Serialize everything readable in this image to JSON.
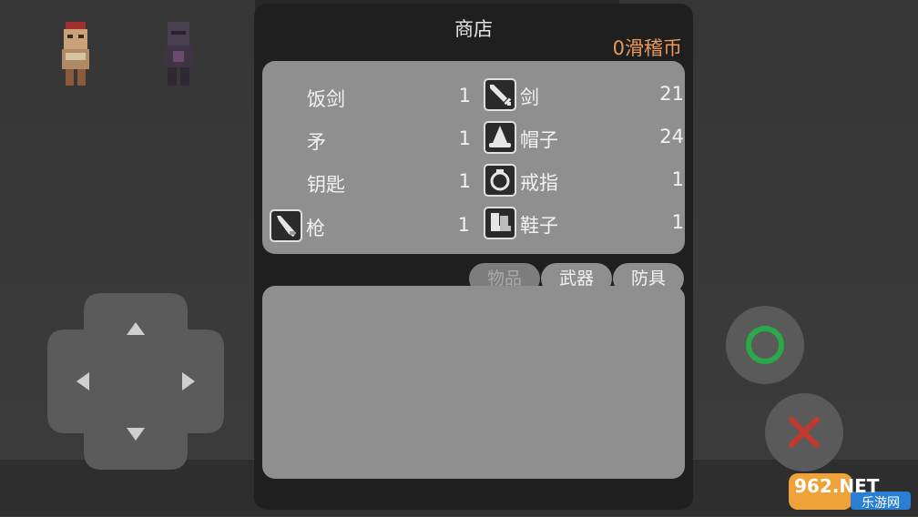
{
  "shop": {
    "title": "商店",
    "currency": "0滑稽币"
  },
  "inventory": {
    "left": [
      {
        "name": "饭剑",
        "qty": "1",
        "icon": null
      },
      {
        "name": "矛",
        "qty": "1",
        "icon": null
      },
      {
        "name": "钥匙",
        "qty": "1",
        "icon": null
      },
      {
        "name": "枪",
        "qty": "1",
        "icon": "gun-icon"
      }
    ],
    "right": [
      {
        "name": "剑",
        "qty": "21",
        "icon": "sword-icon"
      },
      {
        "name": "帽子",
        "qty": "24",
        "icon": "hat-icon"
      },
      {
        "name": "戒指",
        "qty": "1",
        "icon": "ring-icon"
      },
      {
        "name": "鞋子",
        "qty": "1",
        "icon": "boots-icon"
      }
    ]
  },
  "tabs": {
    "items": "物品",
    "weapons": "武器",
    "armor": "防具"
  },
  "watermark": {
    "line1": "962.NET",
    "line2": "乐游网"
  },
  "colors": {
    "currency": "#e9995a",
    "confirm": "#2aa84a",
    "cancel": "#c0392b"
  }
}
